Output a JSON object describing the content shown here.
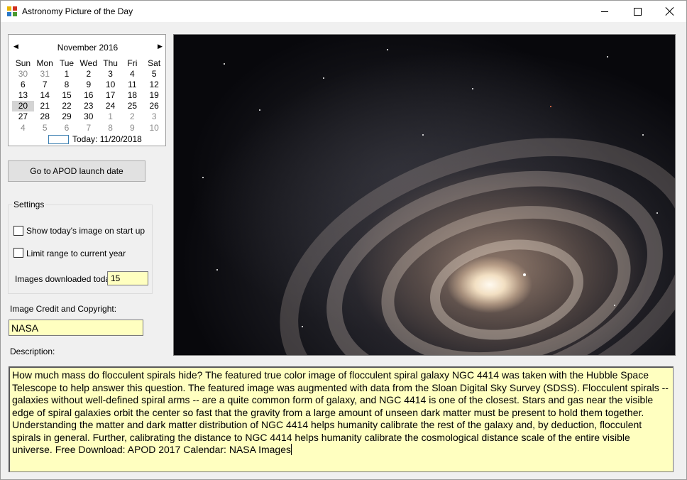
{
  "window": {
    "title": "Astronomy Picture of the Day",
    "icon": "apod-app-icon",
    "controls": [
      "minimize",
      "maximize",
      "close"
    ]
  },
  "calendar": {
    "month_label": "November 2016",
    "prev_icon": "◀",
    "next_icon": "▶",
    "day_headers": [
      "Sun",
      "Mon",
      "Tue",
      "Wed",
      "Thu",
      "Fri",
      "Sat"
    ],
    "weeks": [
      [
        {
          "d": "30",
          "other": true
        },
        {
          "d": "31",
          "other": true
        },
        {
          "d": "1"
        },
        {
          "d": "2"
        },
        {
          "d": "3"
        },
        {
          "d": "4"
        },
        {
          "d": "5"
        }
      ],
      [
        {
          "d": "6"
        },
        {
          "d": "7"
        },
        {
          "d": "8"
        },
        {
          "d": "9"
        },
        {
          "d": "10"
        },
        {
          "d": "11"
        },
        {
          "d": "12"
        }
      ],
      [
        {
          "d": "13"
        },
        {
          "d": "14"
        },
        {
          "d": "15"
        },
        {
          "d": "16"
        },
        {
          "d": "17"
        },
        {
          "d": "18"
        },
        {
          "d": "19"
        }
      ],
      [
        {
          "d": "20",
          "selected": true
        },
        {
          "d": "21"
        },
        {
          "d": "22"
        },
        {
          "d": "23"
        },
        {
          "d": "24"
        },
        {
          "d": "25"
        },
        {
          "d": "26"
        }
      ],
      [
        {
          "d": "27"
        },
        {
          "d": "28"
        },
        {
          "d": "29"
        },
        {
          "d": "30"
        },
        {
          "d": "1",
          "other": true
        },
        {
          "d": "2",
          "other": true
        },
        {
          "d": "3",
          "other": true
        }
      ],
      [
        {
          "d": "4",
          "other": true
        },
        {
          "d": "5",
          "other": true
        },
        {
          "d": "6",
          "other": true
        },
        {
          "d": "7",
          "other": true
        },
        {
          "d": "8",
          "other": true
        },
        {
          "d": "9",
          "other": true
        },
        {
          "d": "10",
          "other": true
        }
      ]
    ],
    "today_label": "Today: 11/20/2018"
  },
  "launch_button_label": "Go to APOD launch date",
  "settings": {
    "legend": "Settings",
    "show_today_label": "Show today's image on start up",
    "show_today_checked": false,
    "limit_range_label": "Limit range to current year",
    "limit_range_checked": false,
    "downloaded_label": "Images downloaded today:",
    "downloaded_value": "15"
  },
  "credit": {
    "label": "Image Credit and Copyright:",
    "value": "NASA"
  },
  "description": {
    "label": "Description:",
    "text": "How much mass do flocculent spirals hide?  The featured true color image of flocculent spiral galaxy NGC 4414 was taken with the Hubble Space Telescope to help answer this question. The featured image was augmented with data from the Sloan Digital Sky Survey (SDSS).  Flocculent spirals -- galaxies without well-defined spiral arms -- are a quite common form of galaxy, and NGC 4414 is one of the closest.  Stars and gas near the visible edge of spiral galaxies orbit the center so fast that the gravity from a large amount of unseen dark matter must be present to hold them together.  Understanding the matter and dark matter distribution of NGC 4414 helps humanity calibrate the rest of the galaxy and, by deduction, flocculent spirals in general.  Further, calibrating the distance to NGC 4414 helps  humanity calibrate the cosmological distance scale of the entire  visible universe.   Free Download: APOD 2017 Calendar: NASA Images"
  },
  "colors": {
    "input_background": "#ffffc0",
    "window_background": "#f0f0f0",
    "selected_day": "#d4d4d4",
    "today_outline": "#3c7fb1"
  }
}
